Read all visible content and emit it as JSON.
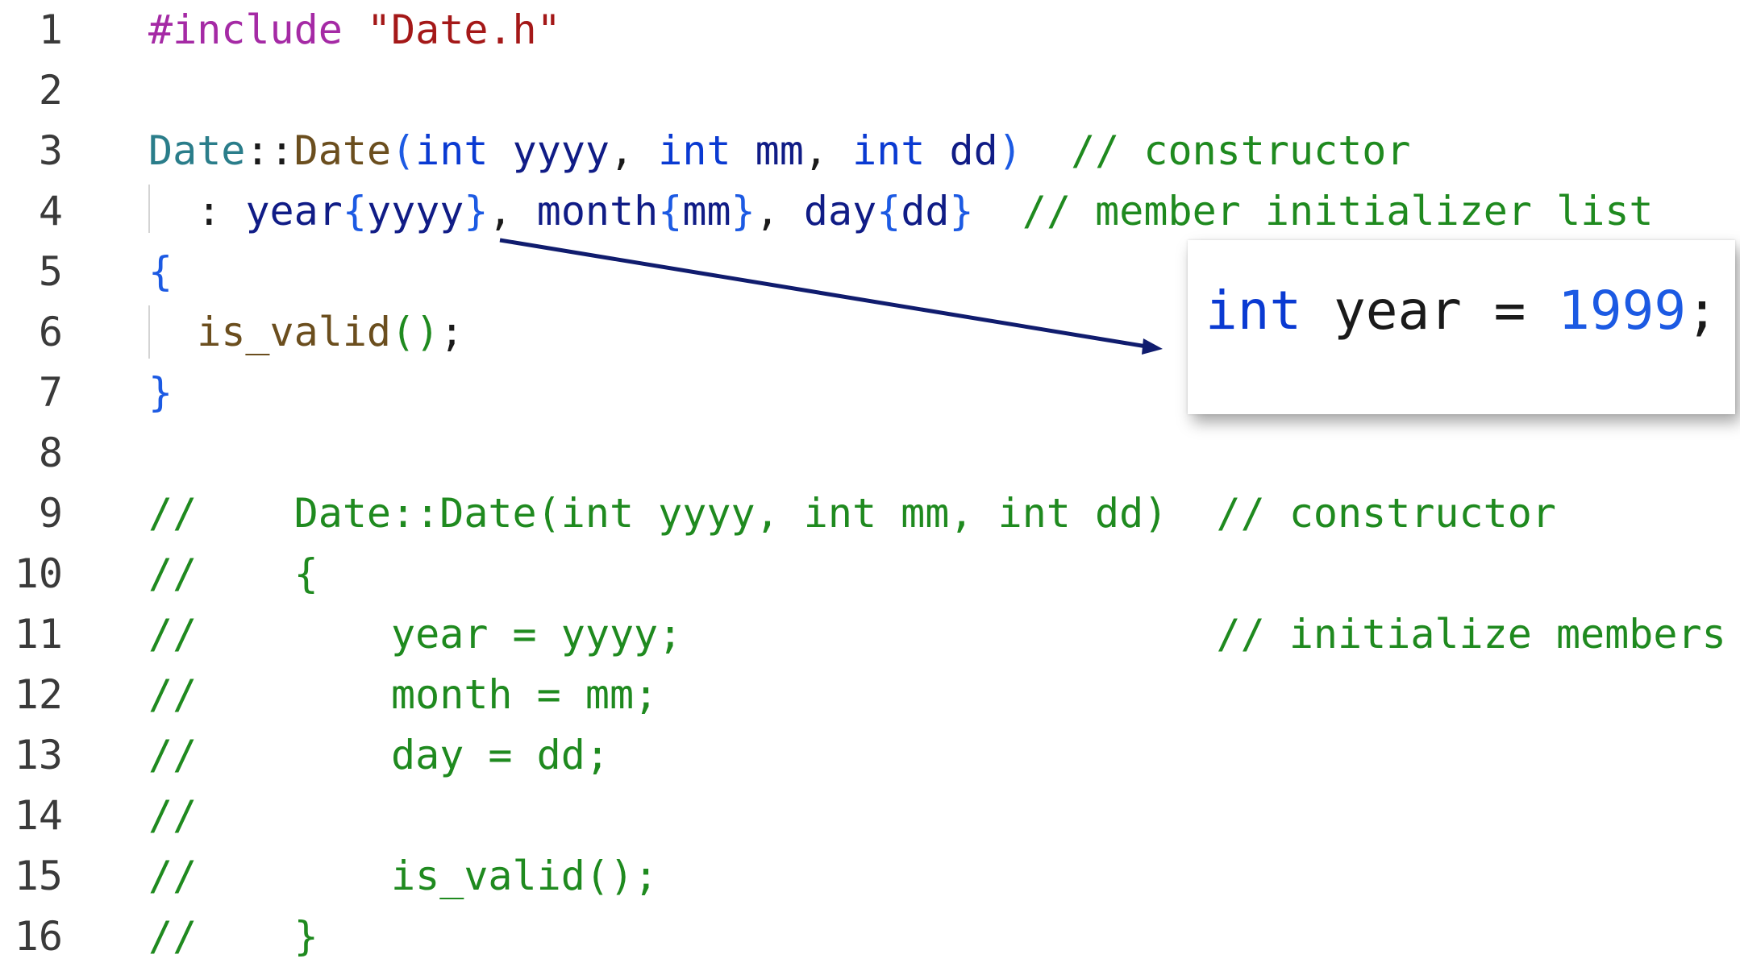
{
  "line_numbers": [
    "1",
    "2",
    "3",
    "4",
    "5",
    "6",
    "7",
    "8",
    "9",
    "10",
    "11",
    "12",
    "13",
    "14",
    "15",
    "16"
  ],
  "code": {
    "l1": {
      "pp": "#include",
      "st": "\"Date.h\""
    },
    "l3": {
      "ty": "Date",
      "scope": "::",
      "fn": "Date",
      "open": "(",
      "kw1": "int",
      "p1": "yyyy",
      "c1": ", ",
      "kw2": "int",
      "p2": "mm",
      "c2": ", ",
      "kw3": "int",
      "p3": "dd",
      "close": ")",
      "comment": "// constructor"
    },
    "l4": {
      "colon": ": ",
      "m1": "year",
      "b1o": "{",
      "a1": "yyyy",
      "b1c": "}",
      "c1": ", ",
      "m2": "month",
      "b2o": "{",
      "a2": "mm",
      "b2c": "}",
      "c2": ", ",
      "m3": "day",
      "b3o": "{",
      "a3": "dd",
      "b3c": "}",
      "comment": "// member initializer list"
    },
    "l5": "{",
    "l6": {
      "fn": "is_valid",
      "parens": "()",
      "semi": ";"
    },
    "l7": "}",
    "l9": "//    Date::Date(int yyyy, int mm, int dd)  // constructor",
    "l10": "//    {",
    "l11": "//        year = yyyy;                      // initialize members",
    "l12": "//        month = mm;",
    "l13": "//        day = dd;",
    "l14": "//",
    "l15": "//        is_valid();",
    "l16": "//    }"
  },
  "tooltip": {
    "kw": "int",
    "name": "year",
    "eq": "=",
    "value": "1999",
    "semi": ";"
  },
  "colors": {
    "keyword": "#0a3ad2",
    "type": "#2a7d8a",
    "function": "#6b4e1e",
    "identifier": "#101c86",
    "comment": "#1f8a1f",
    "preprocessor": "#a52aa5",
    "string": "#a41818",
    "arrow": "#101c6e"
  }
}
